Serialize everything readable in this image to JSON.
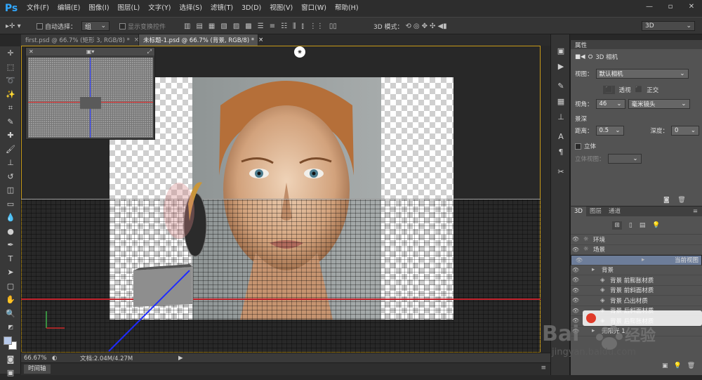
{
  "app": {
    "logo": "Ps"
  },
  "menu": [
    "文件(F)",
    "编辑(E)",
    "图像(I)",
    "图层(L)",
    "文字(Y)",
    "选择(S)",
    "滤镜(T)",
    "3D(D)",
    "视图(V)",
    "窗口(W)",
    "帮助(H)"
  ],
  "window_buttons": [
    "—",
    "▫",
    "✕"
  ],
  "options": {
    "auto_select_label": "自动选择：",
    "auto_select_value": "组",
    "show_transform_label": "显示变换控件",
    "mode_3d_label": "3D 模式：",
    "workspace": "3D"
  },
  "tabs": [
    {
      "label": "first.psd @ 66.7% (矩形 3, RGB/8) *",
      "close": "×"
    },
    {
      "label": "未标题-1.psd @ 66.7% (背景, RGB/8) *",
      "close": "×"
    }
  ],
  "status": {
    "zoom": "66.67%",
    "doc": "文档:2.04M/4.27M"
  },
  "timeline": {
    "label": "时间轴"
  },
  "properties": {
    "panel_title": "属性",
    "subtitle": "3D 相机",
    "view_label": "视图：",
    "view_value": "默认相机",
    "perspective": "透视",
    "ortho": "正交",
    "fov_label": "视角：",
    "fov_value": "46",
    "lens_value": "毫米镜头",
    "dof_label": "景深",
    "distance_label": "距离：",
    "distance_value": "0.5",
    "depth_label": "深度：",
    "depth_value": "0",
    "stereo_label": "立体",
    "stereo_view_label": "立体视图："
  },
  "layers": {
    "tabs": [
      "3D",
      "图层",
      "通道"
    ],
    "rows": [
      {
        "label": "环境",
        "indent": 0
      },
      {
        "label": "场景",
        "indent": 0
      },
      {
        "label": "当前视图",
        "indent": 1,
        "selected": true
      },
      {
        "label": "背景",
        "indent": 1
      },
      {
        "label": "背景 前膨胀材质",
        "indent": 2
      },
      {
        "label": "背景 前斜面材质",
        "indent": 2
      },
      {
        "label": "背景 凸出材质",
        "indent": 2
      },
      {
        "label": "背景 后斜面材质",
        "indent": 2
      },
      {
        "label": "背景 后膨胀材质",
        "indent": 2
      },
      {
        "label": "无限光 1",
        "indent": 1
      }
    ]
  },
  "watermark": {
    "brand": "Bai",
    "brand2": "经验",
    "url": "jingyan.baidu.com"
  }
}
